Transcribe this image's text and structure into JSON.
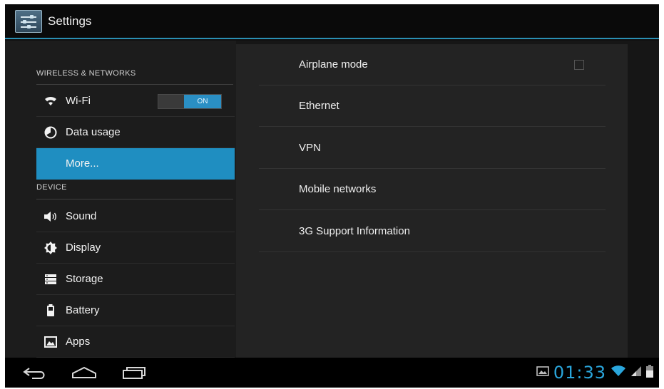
{
  "app": {
    "title": "Settings",
    "icon": "settings-sliders-icon"
  },
  "sidebar": {
    "sections": [
      {
        "header": "WIRELESS & NETWORKS",
        "items": [
          {
            "label": "Wi-Fi",
            "icon": "wifi-icon",
            "toggle": "ON"
          },
          {
            "label": "Data usage",
            "icon": "data-usage-icon"
          },
          {
            "label": "More...",
            "icon": "",
            "selected": true
          }
        ]
      },
      {
        "header": "DEVICE",
        "items": [
          {
            "label": "Sound",
            "icon": "speaker-icon"
          },
          {
            "label": "Display",
            "icon": "brightness-icon"
          },
          {
            "label": "Storage",
            "icon": "storage-icon"
          },
          {
            "label": "Battery",
            "icon": "battery-icon"
          },
          {
            "label": "Apps",
            "icon": "apps-icon"
          }
        ]
      }
    ]
  },
  "detail": {
    "items": [
      {
        "label": "Airplane mode",
        "checkbox": false
      },
      {
        "label": "Ethernet"
      },
      {
        "label": "VPN"
      },
      {
        "label": "Mobile networks"
      },
      {
        "label": "3G Support Information"
      }
    ]
  },
  "navbar": {
    "back_icon": "back-icon",
    "home_icon": "home-icon",
    "recents_icon": "recent-apps-icon"
  },
  "status": {
    "time": "01:33",
    "icons": [
      "gallery-notification-icon",
      "wifi-signal-icon",
      "cell-signal-icon",
      "battery-status-icon"
    ]
  },
  "colors": {
    "accent": "#1f8ec1",
    "clock": "#2aa6dc",
    "background": "#161616"
  }
}
